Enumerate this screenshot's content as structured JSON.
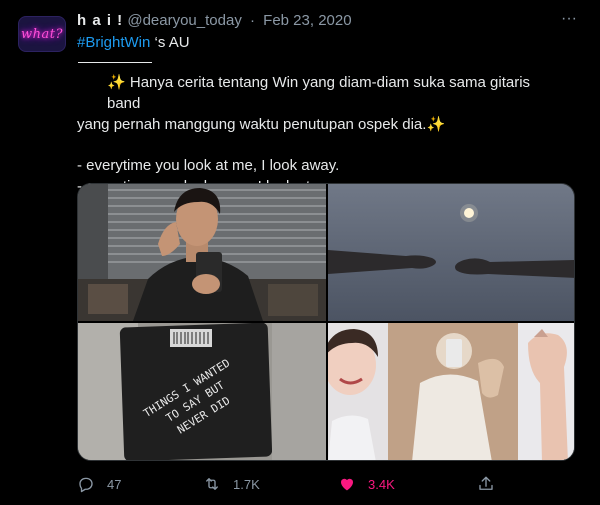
{
  "tweet": {
    "avatar_text": "what?",
    "display_name": "h a i !",
    "handle": "@dearyou_today",
    "separator": "·",
    "date": "Feb 23, 2020",
    "more_label": "···",
    "hashtag": "#BrightWin",
    "hashtag_suffix": " ‘s AU",
    "sparkle": "✨",
    "line1": " Hanya cerita tentang Win yang diam-diam suka sama gitaris band",
    "line2": "yang pernah manggung waktu penutupan ospek dia.",
    "quote1": "- everytime you look at me, I look away.",
    "quote2": "- everytime you look away, I look at you.",
    "notebook_text": [
      "THINGS I WANTED",
      "TO SAY BUT",
      "NEVER DID"
    ]
  },
  "actions": {
    "replies": "47",
    "retweets": "1.7K",
    "likes": "3.4K"
  },
  "colors": {
    "background": "#000000",
    "accent": "#1d9bf0",
    "like": "#f91880",
    "muted": "#8b98a5"
  },
  "icons": [
    "reply-icon",
    "retweet-icon",
    "heart-icon",
    "share-icon",
    "more-icon"
  ]
}
